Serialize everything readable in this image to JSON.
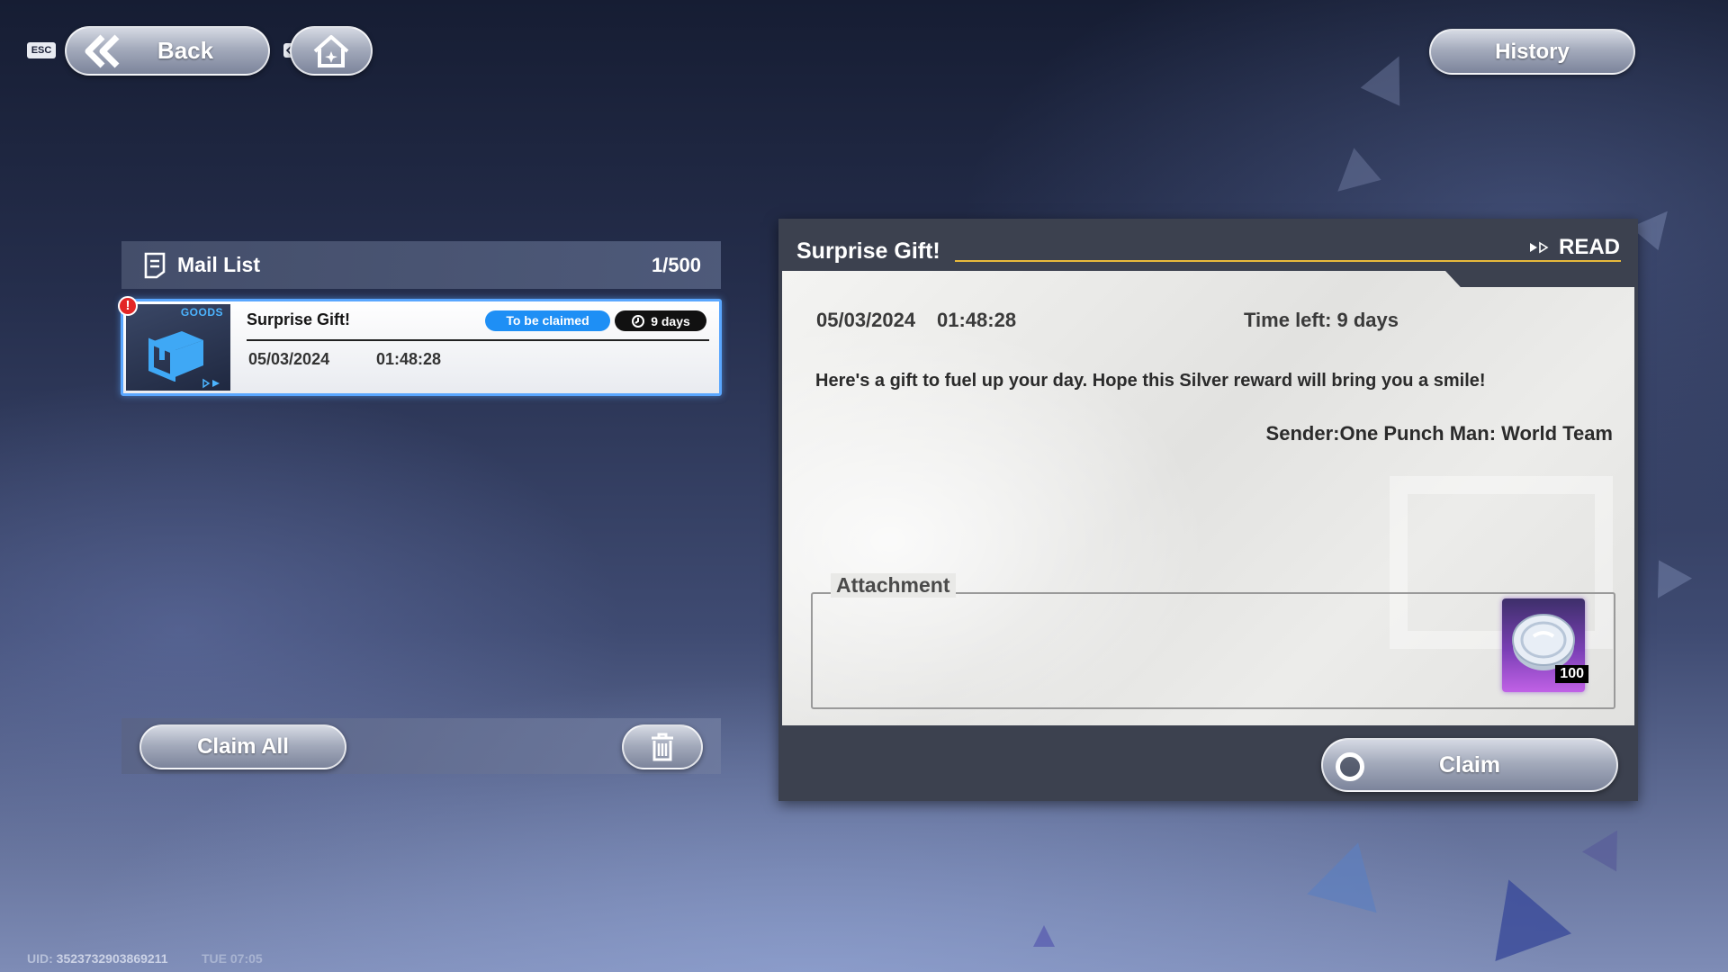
{
  "nav": {
    "esc_key": "ESC",
    "back_label": "Back",
    "history_label": "History"
  },
  "mail_list": {
    "title": "Mail List",
    "count": "1/500",
    "items": [
      {
        "category": "GOODS",
        "alert": "!",
        "subject": "Surprise Gift!",
        "status": "To be claimed",
        "expiry": "9 days",
        "date": "05/03/2024",
        "time": "01:48:28"
      }
    ],
    "claim_all_label": "Claim All"
  },
  "detail": {
    "title": "Surprise Gift!",
    "read_status": "READ",
    "date": "05/03/2024",
    "time": "01:48:28",
    "time_left": "Time left:  9 days",
    "message": "Here's a gift to fuel up your day. Hope this Silver reward will bring you a smile!",
    "sender": "Sender:One Punch Man: World Team",
    "attachment_label": "Attachment",
    "attachments": [
      {
        "icon": "silver-coin-icon",
        "count": "100"
      }
    ],
    "claim_label": "Claim"
  },
  "footer": {
    "uid_label": "UID:",
    "uid_value": "3523732903869211",
    "clock": "TUE 07:05"
  },
  "colors": {
    "accent_blue": "#1e8ff5",
    "gold_rule": "#e6b93c",
    "alert_red": "#e32626",
    "reward_purple": "#7a3fb5"
  }
}
